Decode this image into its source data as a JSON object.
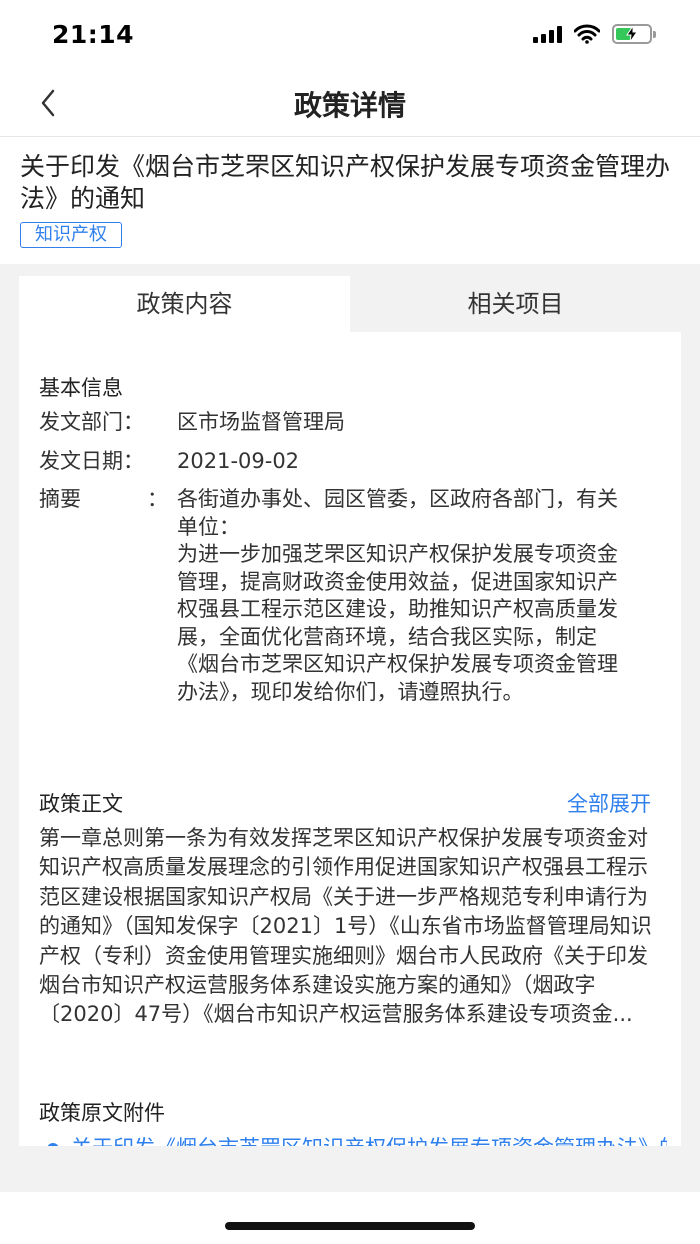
{
  "status_bar": {
    "time": "21:14"
  },
  "nav": {
    "title": "政策详情"
  },
  "policy": {
    "title": "关于印发《烟台市芝罘区知识产权保护发展专项资金管理办法》的通知",
    "tag": "知识产权"
  },
  "tabs": [
    {
      "label": "政策内容",
      "active": true
    },
    {
      "label": "相关项目",
      "active": false
    }
  ],
  "basic_info": {
    "heading": "基本信息",
    "department_label": "发文部门：",
    "department": "区市场监督管理局",
    "date_label": "发文日期：",
    "date": "2021-09-02",
    "summary_label": "摘要",
    "summary_colon": "：",
    "summary": "各街道办事处、园区管委，区政府各部门，有关单位：\n为进一步加强芝罘区知识产权保护发展专项资金管理，提高财政资金使用效益，促进国家知识产权强县工程示范区建设，助推知识产权高质量发展，全面优化营商环境，结合我区实际，制定《烟台市芝罘区知识产权保护发展专项资金管理办法》，现印发给你们，请遵照执行。"
  },
  "policy_body": {
    "heading": "政策正文",
    "expand_label": "全部展开",
    "text": "第一章总则第一条为有效发挥芝罘区知识产权保护发展专项资金对知识产权高质量发展理念的引领作用促进国家知识产权强县工程示范区建设根据国家知识产权局《关于进一步严格规范专利申请行为的通知》（国知发保字〔2021〕1号）《山东省市场监督管理局知识产权（专利）资金使用管理实施细则》烟台市人民政府《关于印发烟台市知识产权运营服务体系建设实施方案的通知》（烟政字〔2020〕47号）《烟台市知识产权运营服务体系建设专项资金..."
  },
  "attachments": {
    "heading": "政策原文附件",
    "items": [
      "关于印发《烟台市芝罘区知识产权保护发展专项资金管理办法》的通知"
    ]
  },
  "colors": {
    "accent": "#2f80ed",
    "background_gray": "#f2f2f2",
    "battery_green": "#34c759"
  },
  "icons": [
    "back-arrow-icon",
    "cellular-signal-icon",
    "wifi-icon",
    "battery-charging-icon",
    "attachment-dot-icon"
  ]
}
